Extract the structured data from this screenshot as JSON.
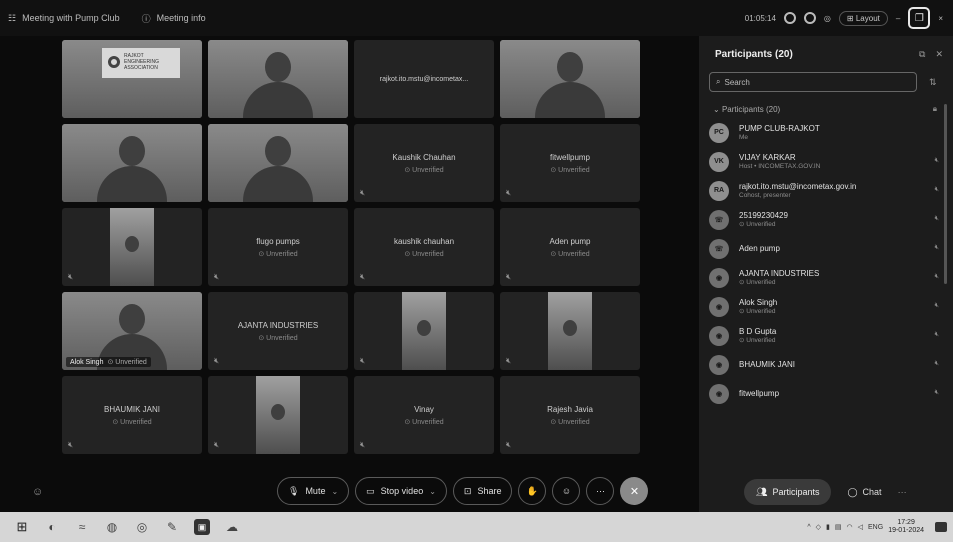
{
  "titlebar": {
    "meeting_name": "Meeting with Pump Club",
    "meeting_info": "Meeting info",
    "timer": "01:05:14",
    "layout_label": "Layout",
    "minimize": "–",
    "close": "×"
  },
  "tiles": [
    {
      "type": "video",
      "variant": "room",
      "sign_lines": [
        "RAJKOT",
        "ENGINEERING",
        "ASSOCIATION"
      ]
    },
    {
      "type": "video",
      "variant": "person"
    },
    {
      "type": "name",
      "name": "rajkot.ito.mstu@incometax...",
      "unverified": ""
    },
    {
      "type": "video",
      "variant": "person"
    },
    {
      "type": "video",
      "variant": "person"
    },
    {
      "type": "video",
      "variant": "person"
    },
    {
      "type": "name",
      "name": "Kaushik Chauhan",
      "unverified": "⊙ Unverified"
    },
    {
      "type": "name",
      "name": "fitwellpump",
      "unverified": "⊙ Unverified"
    },
    {
      "type": "video",
      "variant": "narrow"
    },
    {
      "type": "name",
      "name": "flugo pumps",
      "unverified": "⊙ Unverified"
    },
    {
      "type": "name",
      "name": "kaushik chauhan",
      "unverified": "⊙ Unverified"
    },
    {
      "type": "name",
      "name": "Aden pump",
      "unverified": "⊙ Unverified"
    },
    {
      "type": "video",
      "variant": "person",
      "label": "Alok Singh",
      "label_sub": "⊙ Unverified"
    },
    {
      "type": "name",
      "name": "AJANTA INDUSTRIES",
      "unverified": "⊙ Unverified"
    },
    {
      "type": "video",
      "variant": "narrow"
    },
    {
      "type": "video",
      "variant": "narrow"
    },
    {
      "type": "name",
      "name": "BHAUMIK JANI",
      "unverified": "⊙ Unverified"
    },
    {
      "type": "video",
      "variant": "narrow"
    },
    {
      "type": "name",
      "name": "Vinay",
      "unverified": "⊙ Unverified"
    },
    {
      "type": "name",
      "name": "Rajesh Javia",
      "unverified": "⊙ Unverified"
    }
  ],
  "controls": {
    "mute": "Mute",
    "stop_video": "Stop video",
    "share": "Share"
  },
  "panel": {
    "title": "Participants (20)",
    "search_placeholder": "Search",
    "section_label": "Participants (20)",
    "participants": [
      {
        "initials": "PC",
        "name": "PUMP CLUB-RAJKOT",
        "sub": "Me"
      },
      {
        "initials": "VK",
        "name": "VIJAY KARKAR",
        "sub": "Host • INCOMETAX.GOV.IN"
      },
      {
        "initials": "RA",
        "name": "rajkot.ito.mstu@incometax.gov.in",
        "sub": "Cohost, presenter"
      },
      {
        "initials": "☏",
        "name": "25199230429",
        "sub": "⊙ Unverified"
      },
      {
        "initials": "☏",
        "name": "Aden pump",
        "sub": ""
      },
      {
        "initials": "◉",
        "name": "AJANTA INDUSTRIES",
        "sub": "⊙ Unverified"
      },
      {
        "initials": "◉",
        "name": "Alok Singh",
        "sub": "⊙ Unverified"
      },
      {
        "initials": "◉",
        "name": "B D Gupta",
        "sub": "⊙ Unverified"
      },
      {
        "initials": "◉",
        "name": "BHAUMIK JANI",
        "sub": ""
      },
      {
        "initials": "◉",
        "name": "fitwellpump",
        "sub": ""
      }
    ],
    "participants_button": "Participants",
    "chat_button": "Chat"
  },
  "taskbar": {
    "lang": "ENG",
    "time": "17:29",
    "date": "19-01-2024"
  }
}
